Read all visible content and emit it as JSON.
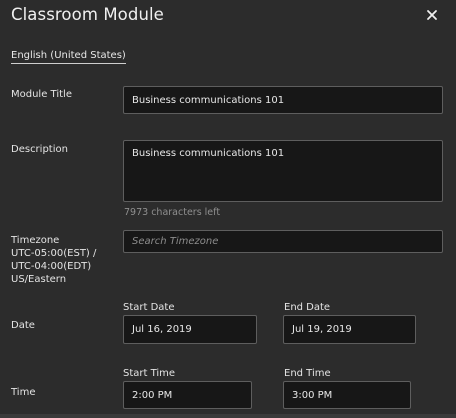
{
  "header": {
    "title": "Classroom Module",
    "close_icon": "close-icon"
  },
  "language": "English (United States)",
  "fields": {
    "module_title": {
      "label": "Module Title",
      "value": "Business communications 101"
    },
    "description": {
      "label": "Description",
      "value": "Business communications 101",
      "hint": "7973 characters left"
    },
    "timezone": {
      "label_lines": [
        "Timezone",
        "UTC-05:00(EST) /",
        "UTC-04:00(EDT)",
        "US/Eastern"
      ],
      "placeholder": "Search Timezone"
    },
    "date": {
      "label": "Date",
      "start_label": "Start Date",
      "start_value": "Jul 16, 2019",
      "end_label": "End Date",
      "end_value": "Jul 19, 2019"
    },
    "time": {
      "label": "Time",
      "start_label": "Start Time",
      "start_value": "2:00 PM",
      "end_label": "End Time",
      "end_value": "3:00 PM"
    }
  },
  "colors": {
    "background": "#2c2c2c",
    "input_background": "#171717",
    "input_border": "#5e5e5e",
    "text": "#e6e6e6",
    "muted": "#8f8f8f"
  }
}
